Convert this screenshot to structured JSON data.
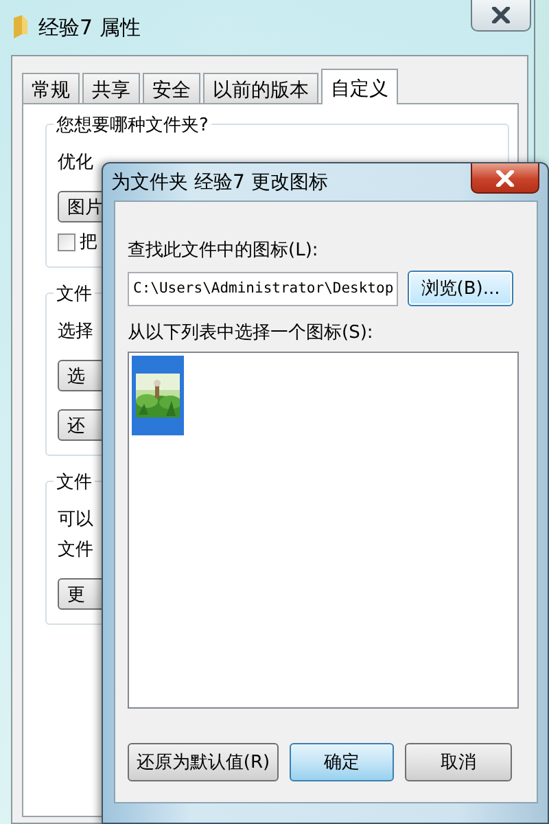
{
  "properties_window": {
    "title": "经验7 属性",
    "tabs": [
      {
        "label": "常规",
        "selected": false
      },
      {
        "label": "共享",
        "selected": false
      },
      {
        "label": "安全",
        "selected": false
      },
      {
        "label": "以前的版本",
        "selected": false
      },
      {
        "label": "自定义",
        "selected": true
      }
    ],
    "groups": [
      {
        "title": "您想要哪种文件夹?",
        "items": [
          {
            "kind": "text",
            "text": "优化"
          },
          {
            "kind": "button",
            "text": "图片"
          },
          {
            "kind": "checkbox",
            "text": "把",
            "checked": false
          }
        ]
      },
      {
        "title": "文件",
        "items": [
          {
            "kind": "text",
            "text": "选择"
          },
          {
            "kind": "button",
            "text": "选"
          },
          {
            "kind": "button",
            "text": "还"
          }
        ]
      },
      {
        "title": "文件",
        "items": [
          {
            "kind": "text",
            "text": "可以"
          },
          {
            "kind": "text",
            "text": "文件"
          },
          {
            "kind": "button",
            "text": "更"
          }
        ]
      }
    ]
  },
  "change_icon_dialog": {
    "title": "为文件夹 经验7 更改图标",
    "find_label": "查找此文件中的图标(L):",
    "path_field": {
      "value": "C:\\Users\\Administrator\\Desktop"
    },
    "browse_button": "浏览(B)...",
    "list_label": "从以下列表中选择一个图标(S):",
    "icons": [
      {
        "kind": "picture",
        "selected": true
      }
    ],
    "buttons": [
      {
        "label": "还原为默认值(R)",
        "default": false
      },
      {
        "label": "确定",
        "default": true
      },
      {
        "label": "取消",
        "default": false
      }
    ]
  }
}
